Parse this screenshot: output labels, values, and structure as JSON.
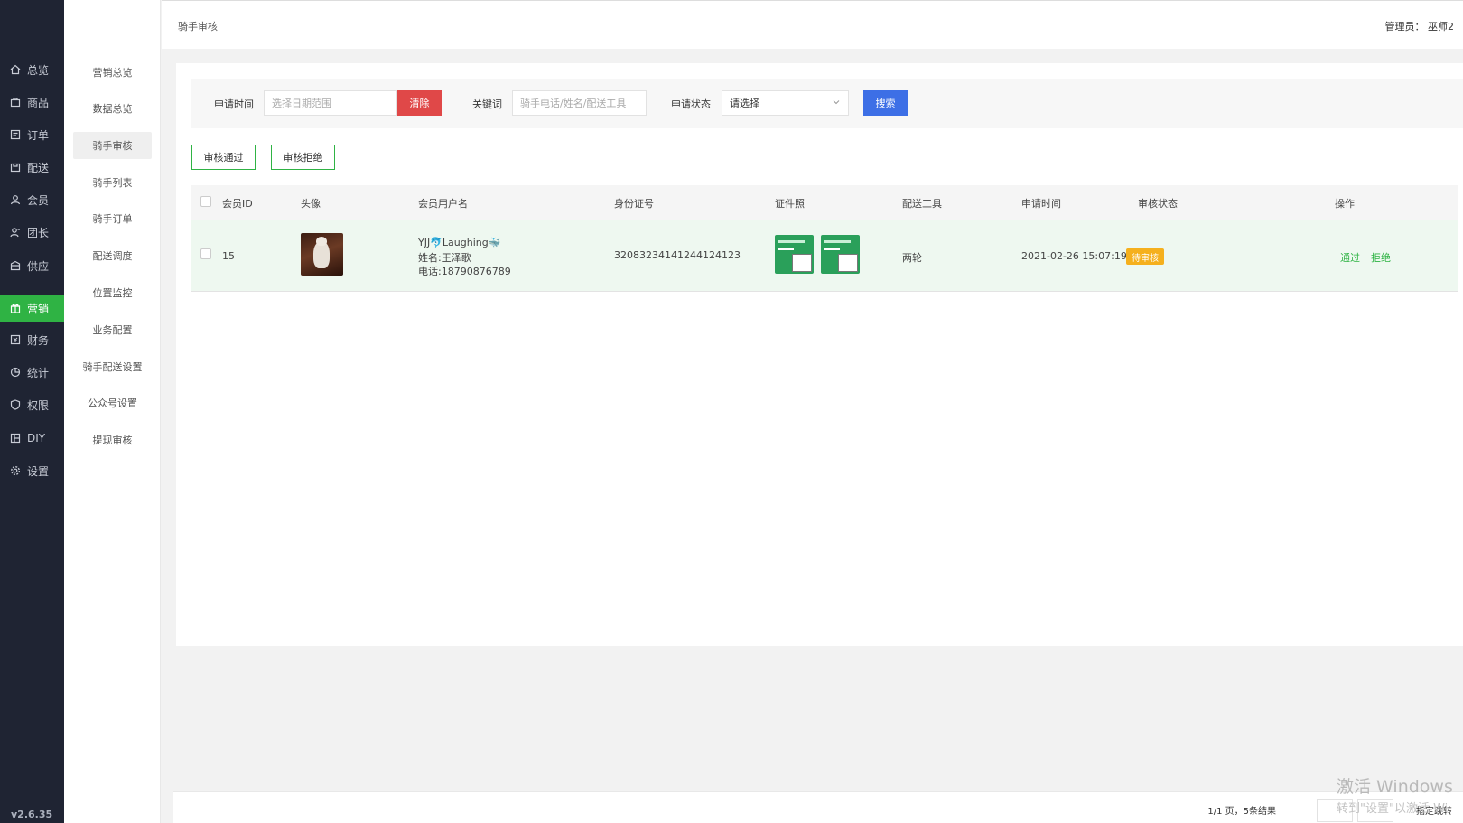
{
  "sidebar": {
    "items": [
      {
        "label": "总览",
        "icon": "home-icon"
      },
      {
        "label": "商品",
        "icon": "bag-icon"
      },
      {
        "label": "订单",
        "icon": "order-icon"
      },
      {
        "label": "配送",
        "icon": "delivery-icon"
      },
      {
        "label": "会员",
        "icon": "user-icon"
      },
      {
        "label": "团长",
        "icon": "leader-icon"
      },
      {
        "label": "供应",
        "icon": "supply-icon"
      },
      {
        "label": "营销",
        "icon": "gift-icon"
      },
      {
        "label": "财务",
        "icon": "finance-icon"
      },
      {
        "label": "统计",
        "icon": "stats-icon"
      },
      {
        "label": "权限",
        "icon": "shield-icon"
      },
      {
        "label": "DIY",
        "icon": "layout-icon"
      },
      {
        "label": "设置",
        "icon": "gear-icon"
      }
    ],
    "active_index": 7,
    "version": "v2.6.35"
  },
  "subnav": {
    "items": [
      "营销总览",
      "数据总览",
      "骑手审核",
      "骑手列表",
      "骑手订单",
      "配送调度",
      "位置监控",
      "业务配置",
      "骑手配送设置",
      "公众号设置",
      "提现审核"
    ],
    "active_index": 2
  },
  "header": {
    "breadcrumb": "骑手审核",
    "admin": "管理员：  巫师2"
  },
  "filter": {
    "apply_time_label": "申请时间",
    "date_placeholder": "选择日期范围",
    "clear_label": "清除",
    "keyword_label": "关键词",
    "keyword_placeholder": "骑手电话/姓名/配送工具",
    "status_label": "申请状态",
    "status_value": "请选择",
    "search_label": "搜索"
  },
  "actions": {
    "approve_label": "审核通过",
    "reject_label": "审核拒绝"
  },
  "table": {
    "columns": [
      "会员ID",
      "头像",
      "会员用户名",
      "身份证号",
      "证件照",
      "配送工具",
      "申请时间",
      "审核状态",
      "操作"
    ],
    "rows": [
      {
        "id": "15",
        "username": "YJJ🐬Laughing🐳",
        "name": "姓名:王泽歌",
        "phone": "电话:18790876789",
        "id_number": "32083234141244124123",
        "tool": "两轮",
        "apply_time": "2021-02-26 15:07:19",
        "status": "待审核",
        "op_pass": "通过",
        "op_reject": "拒绝"
      }
    ]
  },
  "pagination": {
    "info": "1/1 页，5条结果",
    "jump_label": "指定跳转"
  },
  "watermark": {
    "line1": "激活 Windows",
    "line2": "转到\"设置\"以激活 Wi"
  },
  "colors": {
    "sidebar_bg": "#1f2433",
    "accent_green": "#2fb344",
    "danger_red": "#e04848",
    "primary_blue": "#3d6fe6",
    "badge_orange": "#f5b01d"
  }
}
